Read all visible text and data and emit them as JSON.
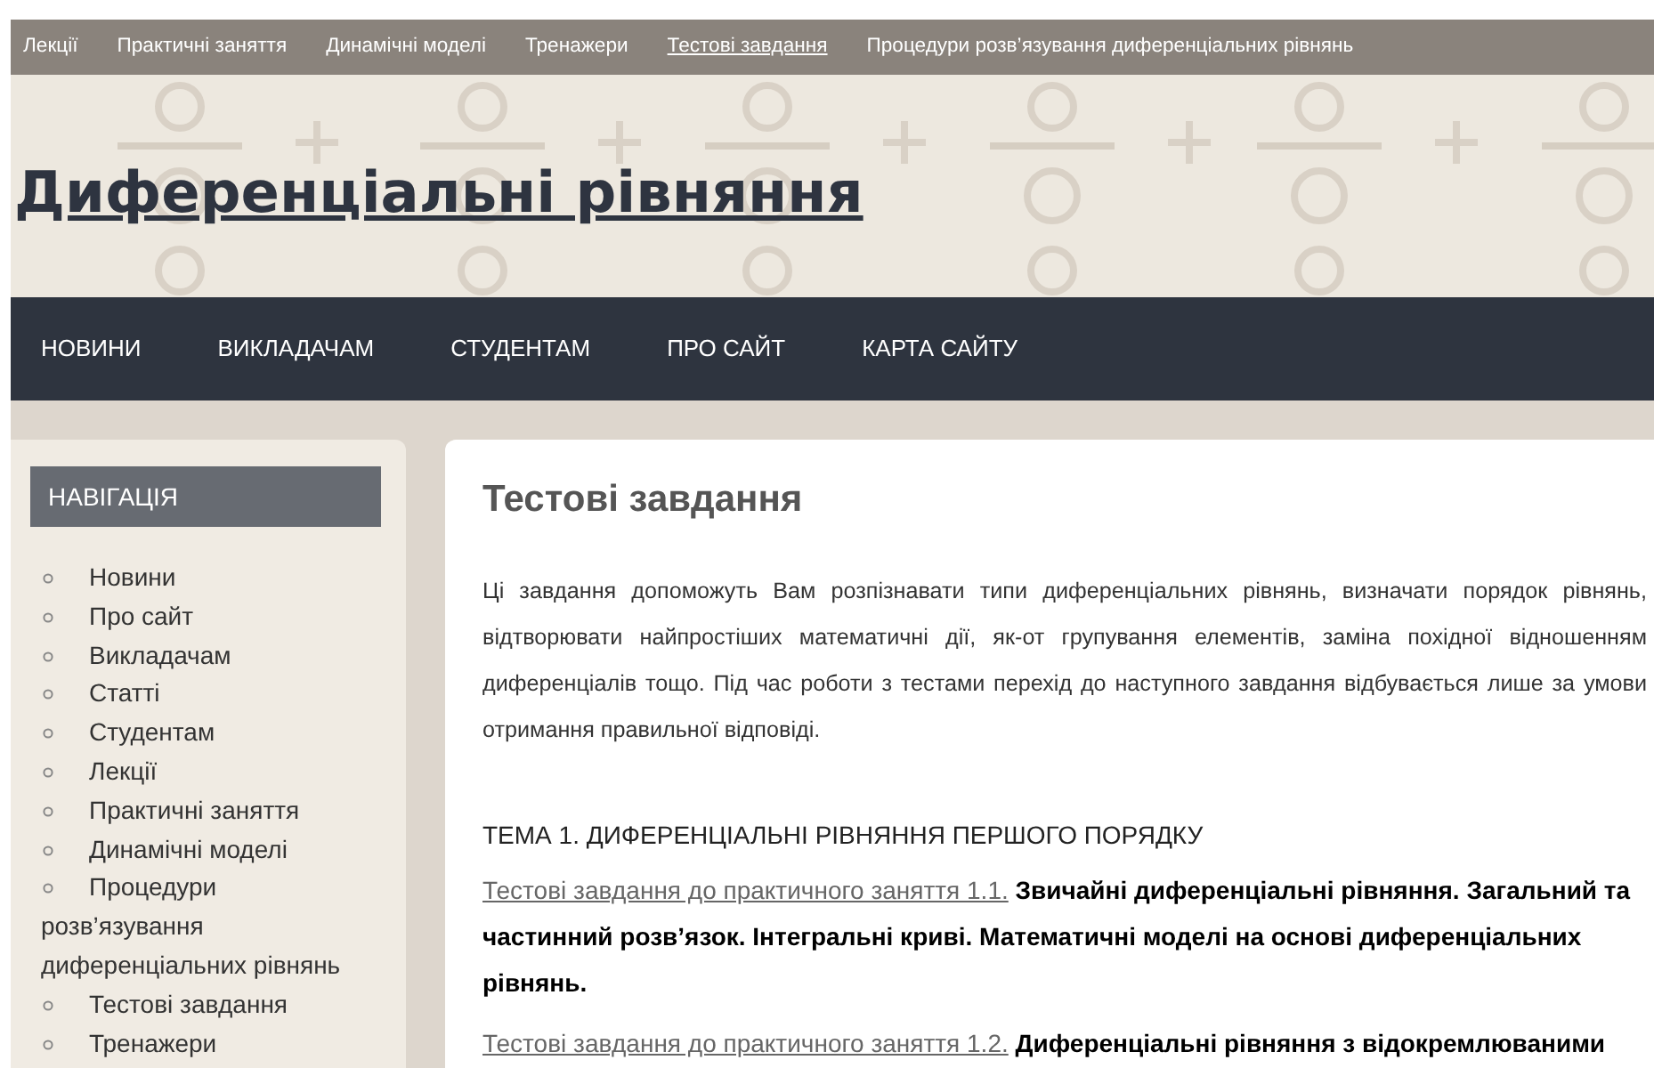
{
  "top_menu": [
    {
      "label": "Лекції",
      "selected": false
    },
    {
      "label": "Практичні заняття",
      "selected": false
    },
    {
      "label": "Динамічні моделі",
      "selected": false
    },
    {
      "label": "Тренажери",
      "selected": false
    },
    {
      "label": "Тестові завдання",
      "selected": true
    },
    {
      "label": "Процедури розв’язування диференціальних рівнянь",
      "selected": false
    }
  ],
  "site_title": "Диференціальні рівняння",
  "main_nav": [
    "НОВИНИ",
    "ВИКЛАДАЧАМ",
    "СТУДЕНТАМ",
    "ПРО САЙТ",
    "КАРТА САЙТУ"
  ],
  "sidebar": {
    "title": "НАВІГАЦІЯ",
    "items": [
      "Новини",
      "Про сайт",
      "Викладачам",
      "Статті",
      "Студентам",
      "Лекції",
      "Практичні заняття",
      "Динамічні моделі",
      "Процедури розв’язування диференціальних рівнянь",
      "Тестові завдання",
      "Тренажери"
    ]
  },
  "content": {
    "heading": "Тестові завдання",
    "intro": "Ці завдання допоможуть Вам розпізнавати типи диференціальних рівнянь, визначати порядок рівнянь, відтворювати найпростіших математичні дії, як-от групування елементів, заміна похідної відношенням диференціалів тощо. Під час роботи з тестами  перехід до наступного завдання відбувається лише за умови отримання правильної відповіді.",
    "topic": "ТЕМА 1. ДИФЕРЕНЦІАЛЬНІ РІВНЯННЯ ПЕРШОГО ПОРЯДКУ",
    "entries": [
      {
        "link": "Тестові завдання до практичного заняття 1.1.",
        "title": "Звичайні диференціальні рівняння. Загальний та частинний розв’язок. Інтегральні криві. Математичні моделі на основі диференціальних рівнянь."
      },
      {
        "link": "Тестові завдання до практичного заняття 1.2.",
        "title": "Диференціальні рівняння з відокремлюваними"
      }
    ]
  }
}
